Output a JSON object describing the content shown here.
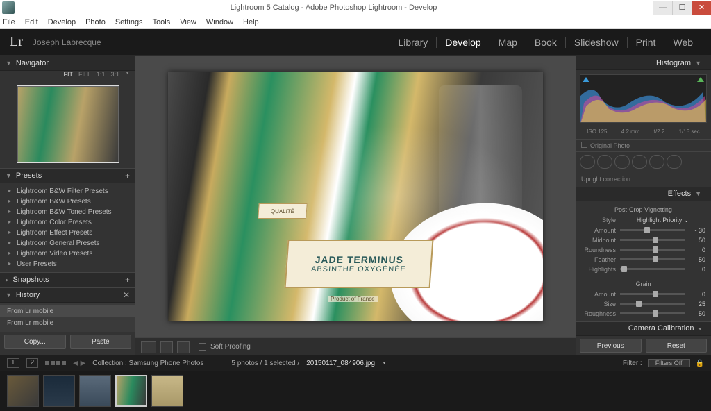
{
  "window": {
    "title": "Lightroom 5 Catalog - Adobe Photoshop Lightroom - Develop"
  },
  "menu": [
    "File",
    "Edit",
    "Develop",
    "Photo",
    "Settings",
    "Tools",
    "View",
    "Window",
    "Help"
  ],
  "identity": {
    "logo": "Lr",
    "user": "Joseph Labrecque",
    "modules": [
      "Library",
      "Develop",
      "Map",
      "Book",
      "Slideshow",
      "Print",
      "Web"
    ],
    "active_module": "Develop"
  },
  "navigator": {
    "title": "Navigator",
    "opts": [
      "FIT",
      "FILL",
      "1:1",
      "3:1"
    ],
    "active_opt": "FIT"
  },
  "presets": {
    "title": "Presets",
    "items": [
      "Lightroom B&W Filter Presets",
      "Lightroom B&W Presets",
      "Lightroom B&W Toned Presets",
      "Lightroom Color Presets",
      "Lightroom Effect Presets",
      "Lightroom General Presets",
      "Lightroom Video Presets",
      "User Presets"
    ]
  },
  "snapshots": {
    "title": "Snapshots"
  },
  "history": {
    "title": "History",
    "items": [
      "From Lr mobile",
      "From Lr mobile"
    ]
  },
  "buttons": {
    "copy": "Copy...",
    "paste": "Paste",
    "previous": "Previous",
    "reset": "Reset"
  },
  "toolbar": {
    "soft_proof": "Soft Proofing"
  },
  "right": {
    "histogram": {
      "title": "Histogram",
      "iso": "ISO 125",
      "focal": "4.2 mm",
      "aperture": "f/2.2",
      "shutter": "1/15 sec",
      "original": "Original Photo"
    },
    "hint": "Upright correction.",
    "effects": {
      "title": "Effects",
      "vignette_title": "Post-Crop Vignetting",
      "style_label": "Style",
      "style_value": "Highlight Priority",
      "sliders": [
        {
          "label": "Amount",
          "value": "- 30",
          "pos": 38
        },
        {
          "label": "Midpoint",
          "value": "50",
          "pos": 50
        },
        {
          "label": "Roundness",
          "value": "0",
          "pos": 50
        },
        {
          "label": "Feather",
          "value": "50",
          "pos": 50
        },
        {
          "label": "Highlights",
          "value": "0",
          "pos": 2
        }
      ],
      "grain_title": "Grain",
      "grain_sliders": [
        {
          "label": "Amount",
          "value": "0",
          "pos": 50
        },
        {
          "label": "Size",
          "value": "25",
          "pos": 25
        },
        {
          "label": "Roughness",
          "value": "50",
          "pos": 50
        }
      ]
    },
    "calibration": {
      "title": "Camera Calibration"
    }
  },
  "strip": {
    "collection_label": "Collection : Samsung Phone Photos",
    "count": "5 photos / 1 selected /",
    "file": "20150117_084906.jpg",
    "filter_label": "Filter :",
    "filter_value": "Filters Off",
    "views": [
      "1",
      "2"
    ]
  },
  "photo": {
    "label_line1": "JADE TERMINUS",
    "label_line2": "ABSINTHE OXYGÉNÉE",
    "qualite": "QUALITÉ",
    "pof": "Product of France"
  }
}
